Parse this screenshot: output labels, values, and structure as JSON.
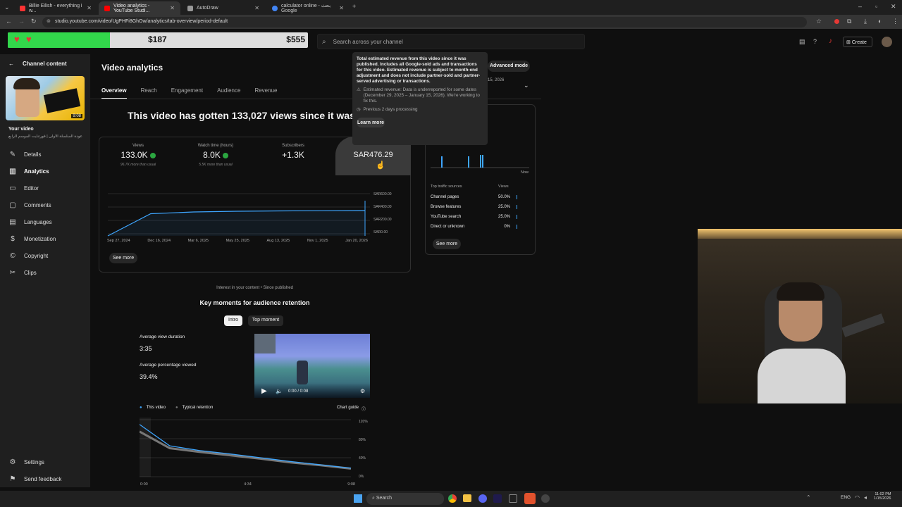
{
  "browser": {
    "tabs": [
      {
        "title": "Billie Eilish - everything i w...",
        "color": "#ff3333",
        "active": false
      },
      {
        "title": "Video analytics - YouTube Studi...",
        "color": "#ff0000",
        "active": true
      },
      {
        "title": "AutoDraw",
        "color": "#999999",
        "active": false
      },
      {
        "title": "calculator online - بحث Google",
        "color": "#4285f4",
        "active": false
      }
    ],
    "url": "studio.youtube.com/video/UgPHFi8GhOw/analytics/tab-overview/period-default"
  },
  "donation": {
    "left": "$187",
    "right": "$555",
    "progress": 0.34
  },
  "search": {
    "placeholder": "Search across your channel"
  },
  "header": {
    "create": "Create"
  },
  "sidebar": {
    "channel_content": "Channel content",
    "your_video": "Your video",
    "video_title": "عودة السلسلة الأولى | فورتنايت الموسم الرابع",
    "duration": "9:08",
    "items": [
      {
        "label": "Details",
        "icon": "pencil-icon"
      },
      {
        "label": "Analytics",
        "icon": "analytics-icon"
      },
      {
        "label": "Editor",
        "icon": "editor-icon"
      },
      {
        "label": "Comments",
        "icon": "comments-icon"
      },
      {
        "label": "Languages",
        "icon": "languages-icon"
      },
      {
        "label": "Monetization",
        "icon": "dollar-icon"
      },
      {
        "label": "Copyright",
        "icon": "copyright-icon"
      },
      {
        "label": "Clips",
        "icon": "scissors-icon"
      }
    ],
    "settings": "Settings",
    "feedback": "Send feedback"
  },
  "page": {
    "title": "Video analytics",
    "advanced": "Advanced mode",
    "date": "15, 2026",
    "tabs": [
      "Overview",
      "Reach",
      "Engagement",
      "Audience",
      "Revenue"
    ],
    "headline": "This video has gotten 133,027 views since it was pul",
    "metrics": [
      {
        "label": "Views",
        "value": "133.0K",
        "sub": "96.7K more than usual",
        "up": true
      },
      {
        "label": "Watch time (hours)",
        "value": "8.0K",
        "sub": "5.5K more than usual",
        "up": true
      },
      {
        "label": "Subscribers",
        "value": "+1.3K",
        "sub": "",
        "up": false
      },
      {
        "label": "",
        "value": "SAR476.29",
        "sub": "",
        "up": false
      }
    ],
    "chart_ylabels": [
      "SAR600.00",
      "SAR400.00",
      "SAR200.00",
      "SAR0.00"
    ],
    "chart_xlabels": [
      "Sep 27, 2024",
      "Dec 16, 2024",
      "Mar 6, 2025",
      "May 25, 2025",
      "Aug 13, 2025",
      "Nov 1, 2025",
      "Jan 20, 2026"
    ],
    "see_more": "See more"
  },
  "chart_data": [
    {
      "type": "line",
      "title": "",
      "x": [
        "Sep 27, 2024",
        "Dec 16, 2024",
        "Mar 6, 2025",
        "May 25, 2025",
        "Aug 13, 2025",
        "Nov 1, 2025",
        "Jan 20, 2026"
      ],
      "values": [
        0,
        315,
        340,
        350,
        355,
        358,
        360
      ],
      "ylim": [
        0,
        600
      ],
      "ylabel": "",
      "xlabel": ""
    },
    {
      "type": "line",
      "title": "Key moments for audience retention",
      "x": [
        "0:00",
        "4:34",
        "9:08"
      ],
      "series": [
        {
          "name": "This video",
          "values": [
            110,
            65,
            55,
            48,
            40,
            32,
            25,
            18
          ]
        },
        {
          "name": "Typical retention",
          "values": [
            95,
            60,
            52,
            45,
            38,
            30,
            24,
            17
          ]
        }
      ],
      "ylim": [
        0,
        120
      ]
    }
  ],
  "tooltip": {
    "text": "Total estimated revenue from this video since it was published. Includes all Google-sold ads and transactions for this video. Estimated revenue is subject to month-end adjustment and does not include partner-sold and partner-served advertising or transactions.",
    "warning": "Estimated revenue: Data is underreported for some dates (December 29, 2025 – January 15, 2026). We're working to fix this.",
    "processing": "Previous 2 days processing",
    "learn": "Learn more"
  },
  "realtime": {
    "now": "Now",
    "sources_title": "Top traffic sources",
    "views_title": "Views",
    "sources": [
      {
        "name": "Channel pages",
        "value": "50.0%",
        "frac": 0.5
      },
      {
        "name": "Browse features",
        "value": "25.0%",
        "frac": 0.25
      },
      {
        "name": "YouTube search",
        "value": "25.0%",
        "frac": 0.25
      },
      {
        "name": "Direct or unknown",
        "value": "0%",
        "frac": 0
      }
    ],
    "see_more": "See more"
  },
  "retention": {
    "interest": "Interest in your content • Since published",
    "title": "Key moments for audience retention",
    "intro": "Intro",
    "top_moment": "Top moment",
    "avg_dur_label": "Average view duration",
    "avg_dur": "3:35",
    "avg_pct_label": "Average percentage viewed",
    "avg_pct": "39.4%",
    "time": "0:00 / 0:08",
    "legend_this": "This video",
    "legend_typical": "Typical retention",
    "chart_guide": "Chart guide",
    "yl": [
      "120%",
      "80%",
      "40%",
      "0%"
    ],
    "xl": [
      "0:00",
      "4:34",
      "9:08"
    ]
  },
  "taskbar": {
    "search": "Search",
    "lang": "ENG",
    "time": "11:02 PM",
    "date": "1/15/2026"
  }
}
